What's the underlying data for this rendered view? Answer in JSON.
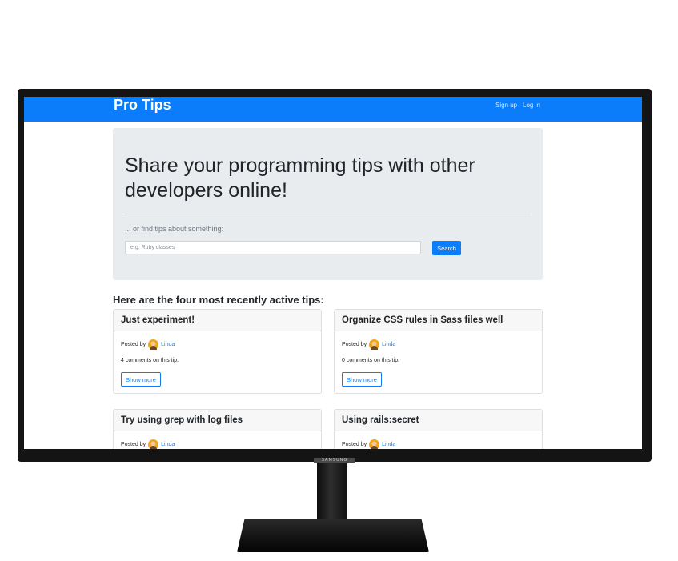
{
  "navbar": {
    "brand": "Pro Tips",
    "signup": "Sign up",
    "login": "Log in"
  },
  "hero": {
    "title": "Share your programming tips with other developers online!",
    "lead": "... or find tips about something:",
    "search_placeholder": "e.g. Ruby classes",
    "search_button": "Search"
  },
  "section_heading": "Here are the four most recently active tips:",
  "cards": [
    {
      "title": "Just experiment!",
      "posted_by": "Posted by",
      "author": "Linda",
      "comments": "4 comments on this tip.",
      "button": "Show more"
    },
    {
      "title": "Organize CSS rules in Sass files well",
      "posted_by": "Posted by",
      "author": "Linda",
      "comments": "0 comments on this tip.",
      "button": "Show more"
    },
    {
      "title": "Try using grep with log files",
      "posted_by": "Posted by",
      "author": "Linda"
    },
    {
      "title": "Using rails:secret",
      "posted_by": "Posted by",
      "author": "Linda"
    }
  ],
  "monitor": {
    "brand": "SAMSUNG"
  },
  "colors": {
    "primary": "#0b7dfb",
    "jumbotron": "#e9ecef",
    "bezel": "#141414"
  },
  "icons": {
    "avatar": "user-avatar-icon"
  }
}
